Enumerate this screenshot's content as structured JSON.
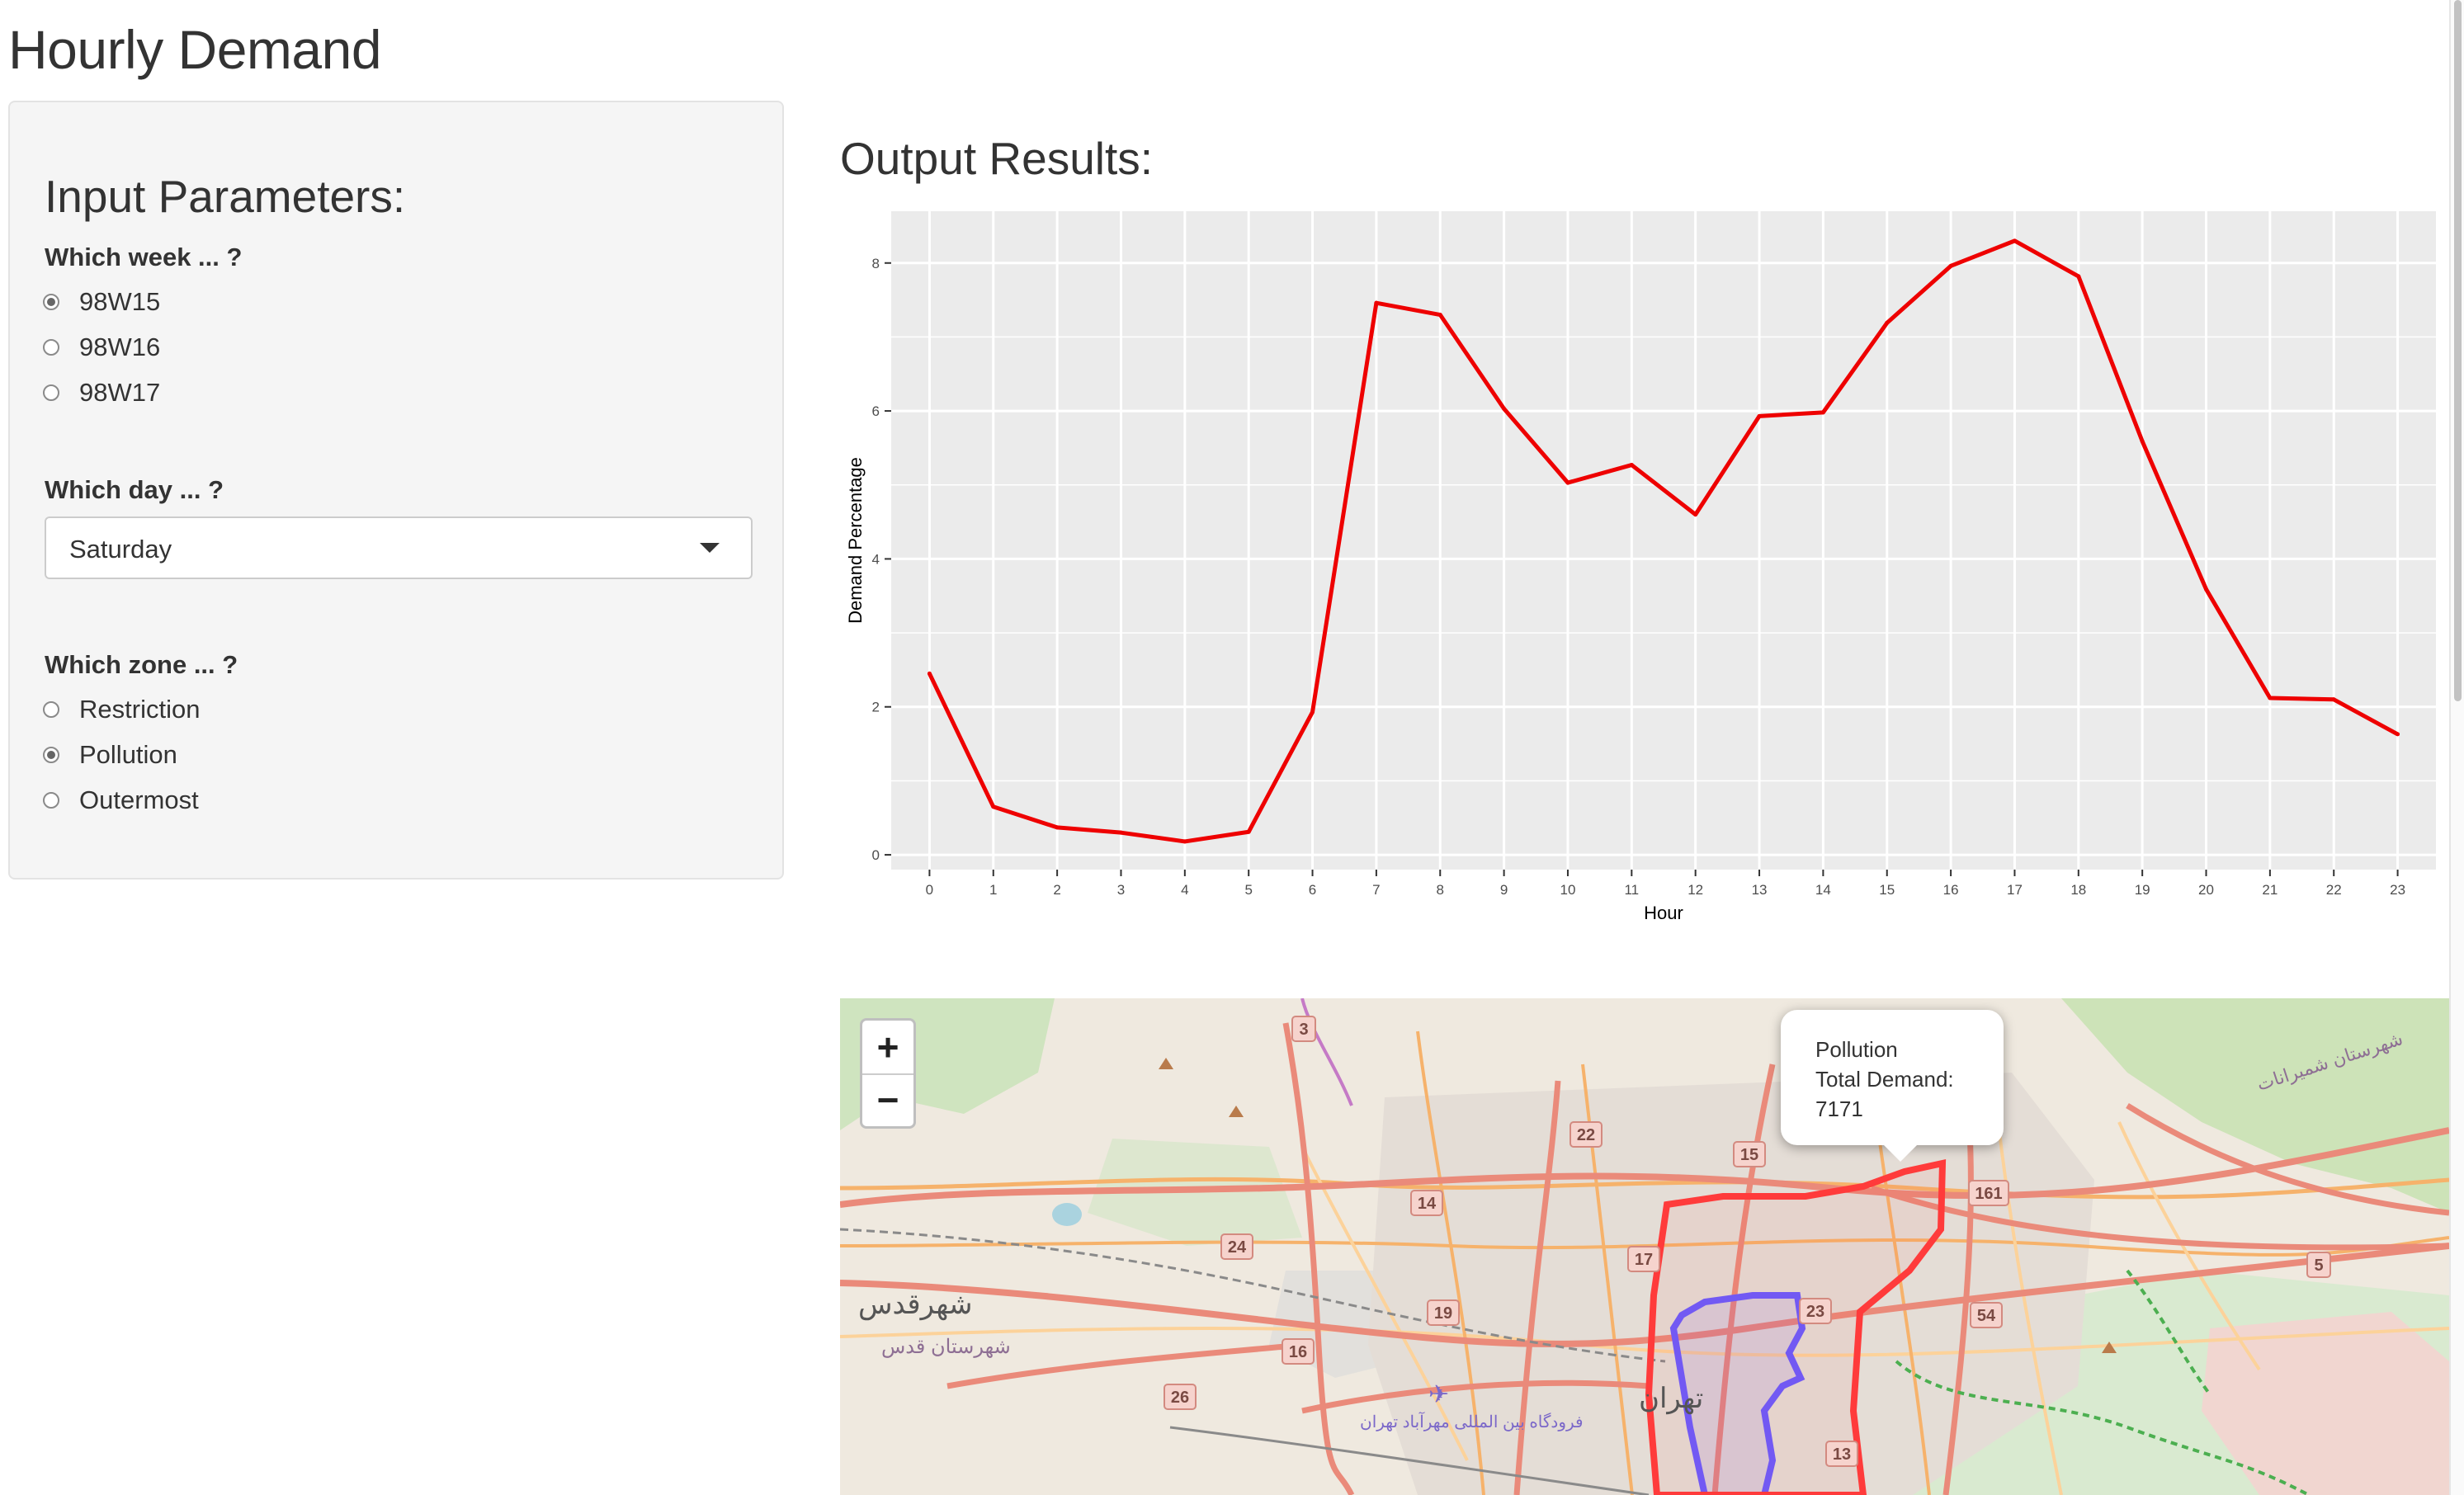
{
  "page": {
    "title": "Hourly Demand"
  },
  "inputs": {
    "heading": "Input Parameters:",
    "week": {
      "label": "Which week ... ?",
      "options": [
        "98W15",
        "98W16",
        "98W17"
      ],
      "selected": "98W15"
    },
    "day": {
      "label": "Which day ... ?",
      "selected": "Saturday"
    },
    "zone": {
      "label": "Which zone ... ?",
      "options": [
        "Restriction",
        "Pollution",
        "Outermost"
      ],
      "selected": "Pollution"
    }
  },
  "output": {
    "heading": "Output Results:"
  },
  "chart_data": {
    "type": "line",
    "xlabel": "Hour",
    "ylabel": "Demand Percentage",
    "x": [
      0,
      1,
      2,
      3,
      4,
      5,
      6,
      7,
      8,
      9,
      10,
      11,
      12,
      13,
      14,
      15,
      16,
      17,
      18,
      19,
      20,
      21,
      22,
      23
    ],
    "series": [
      {
        "values": [
          2.45,
          0.65,
          0.37,
          0.3,
          0.18,
          0.31,
          1.93,
          7.46,
          7.3,
          6.03,
          5.03,
          5.27,
          4.6,
          5.93,
          5.98,
          7.19,
          7.96,
          8.3,
          7.82,
          5.59,
          3.59,
          2.12,
          2.1,
          1.63
        ],
        "color": "#ee0000"
      }
    ],
    "xticks": [
      "0",
      "1",
      "2",
      "3",
      "4",
      "5",
      "6",
      "7",
      "8",
      "9",
      "10",
      "11",
      "12",
      "13",
      "14",
      "15",
      "16",
      "17",
      "18",
      "19",
      "20",
      "21",
      "22",
      "23"
    ],
    "yticks": [
      "0",
      "2",
      "4",
      "6",
      "8"
    ],
    "xlim": [
      -0.6,
      23.6
    ],
    "ylim": [
      -0.2,
      8.7
    ],
    "grid": true,
    "panel_color": "#ebebeb"
  },
  "map": {
    "zoom_in_label": "+",
    "zoom_out_label": "−",
    "popup": {
      "zone": "Pollution",
      "demand_label": "Total Demand:",
      "demand_value": "7171"
    },
    "highway_labels": [
      "3",
      "22",
      "15",
      "161",
      "14",
      "24",
      "17",
      "23",
      "54",
      "5",
      "19",
      "16",
      "26",
      "13"
    ],
    "place_labels": {
      "west_city": "شهرقدس",
      "west_county": "شهرستان قدس",
      "center_city": "تهران",
      "airport": "فرودگاه بین المللی مهرآباد تهران",
      "northeast": "شهرستان شمیرانات"
    },
    "colors": {
      "restriction_zone": "#6a5cff",
      "pollution_zone": "#ff3b3b",
      "base": "#efe9df"
    }
  }
}
